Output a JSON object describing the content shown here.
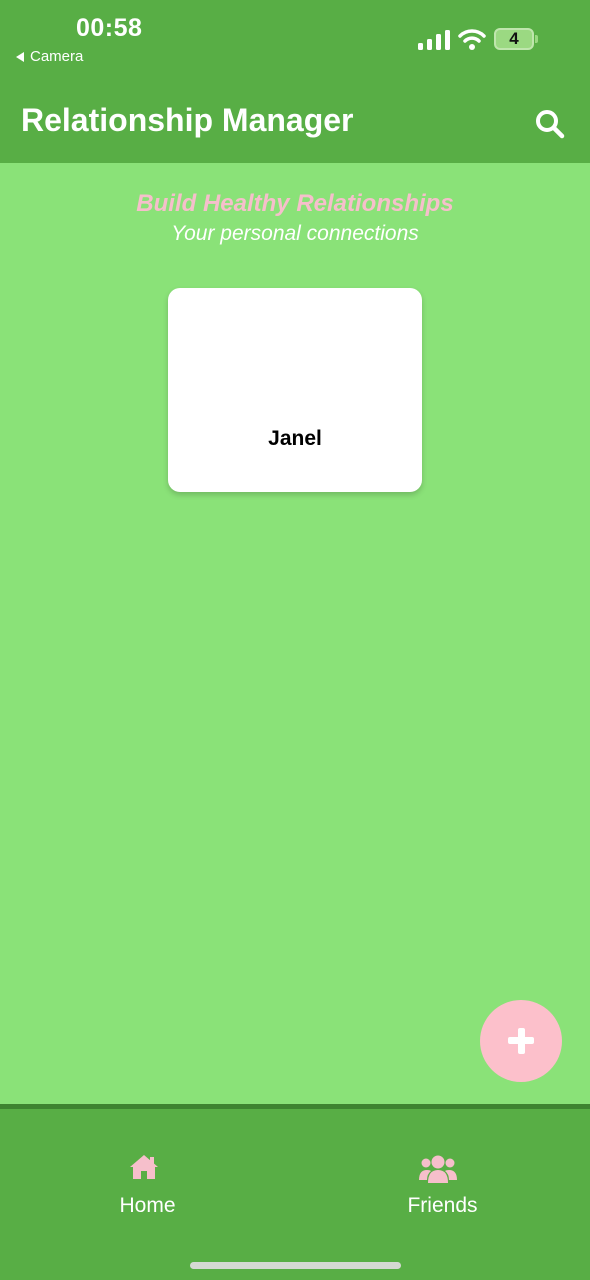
{
  "status_bar": {
    "time": "00:58",
    "back_label": "Camera",
    "battery": "4"
  },
  "app_bar": {
    "title": "Relationship Manager",
    "search_icon": "search-icon"
  },
  "hero": {
    "title": "Build Healthy Relationships",
    "subtitle": "Your personal connections"
  },
  "friends": [
    {
      "name": "Janel"
    }
  ],
  "fab": {
    "icon": "plus-icon"
  },
  "bottom_nav": {
    "items": [
      {
        "label": "Home",
        "icon": "home-icon"
      },
      {
        "label": "Friends",
        "icon": "friends-icon"
      }
    ]
  },
  "colors": {
    "header": "#58AE45",
    "background": "#8AE278",
    "accent_pink": "#FCC0CB",
    "card": "#FFFFFF"
  }
}
